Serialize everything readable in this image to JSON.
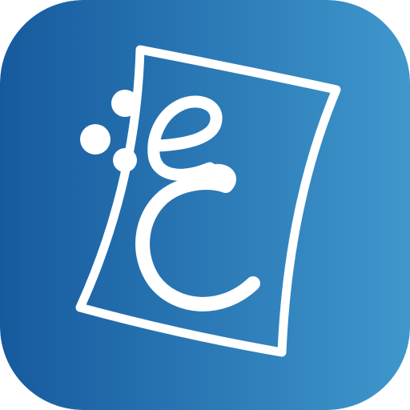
{
  "app_icon": {
    "name": "app-icon",
    "colors": {
      "gradient_start": "#165a9e",
      "gradient_end": "#3f97cc",
      "glyph": "#ffffff"
    },
    "logo_letters": "ec",
    "icon_parts": [
      "card-outline-icon",
      "bubbles-icon",
      "letter-e-icon",
      "letter-c-icon"
    ]
  }
}
